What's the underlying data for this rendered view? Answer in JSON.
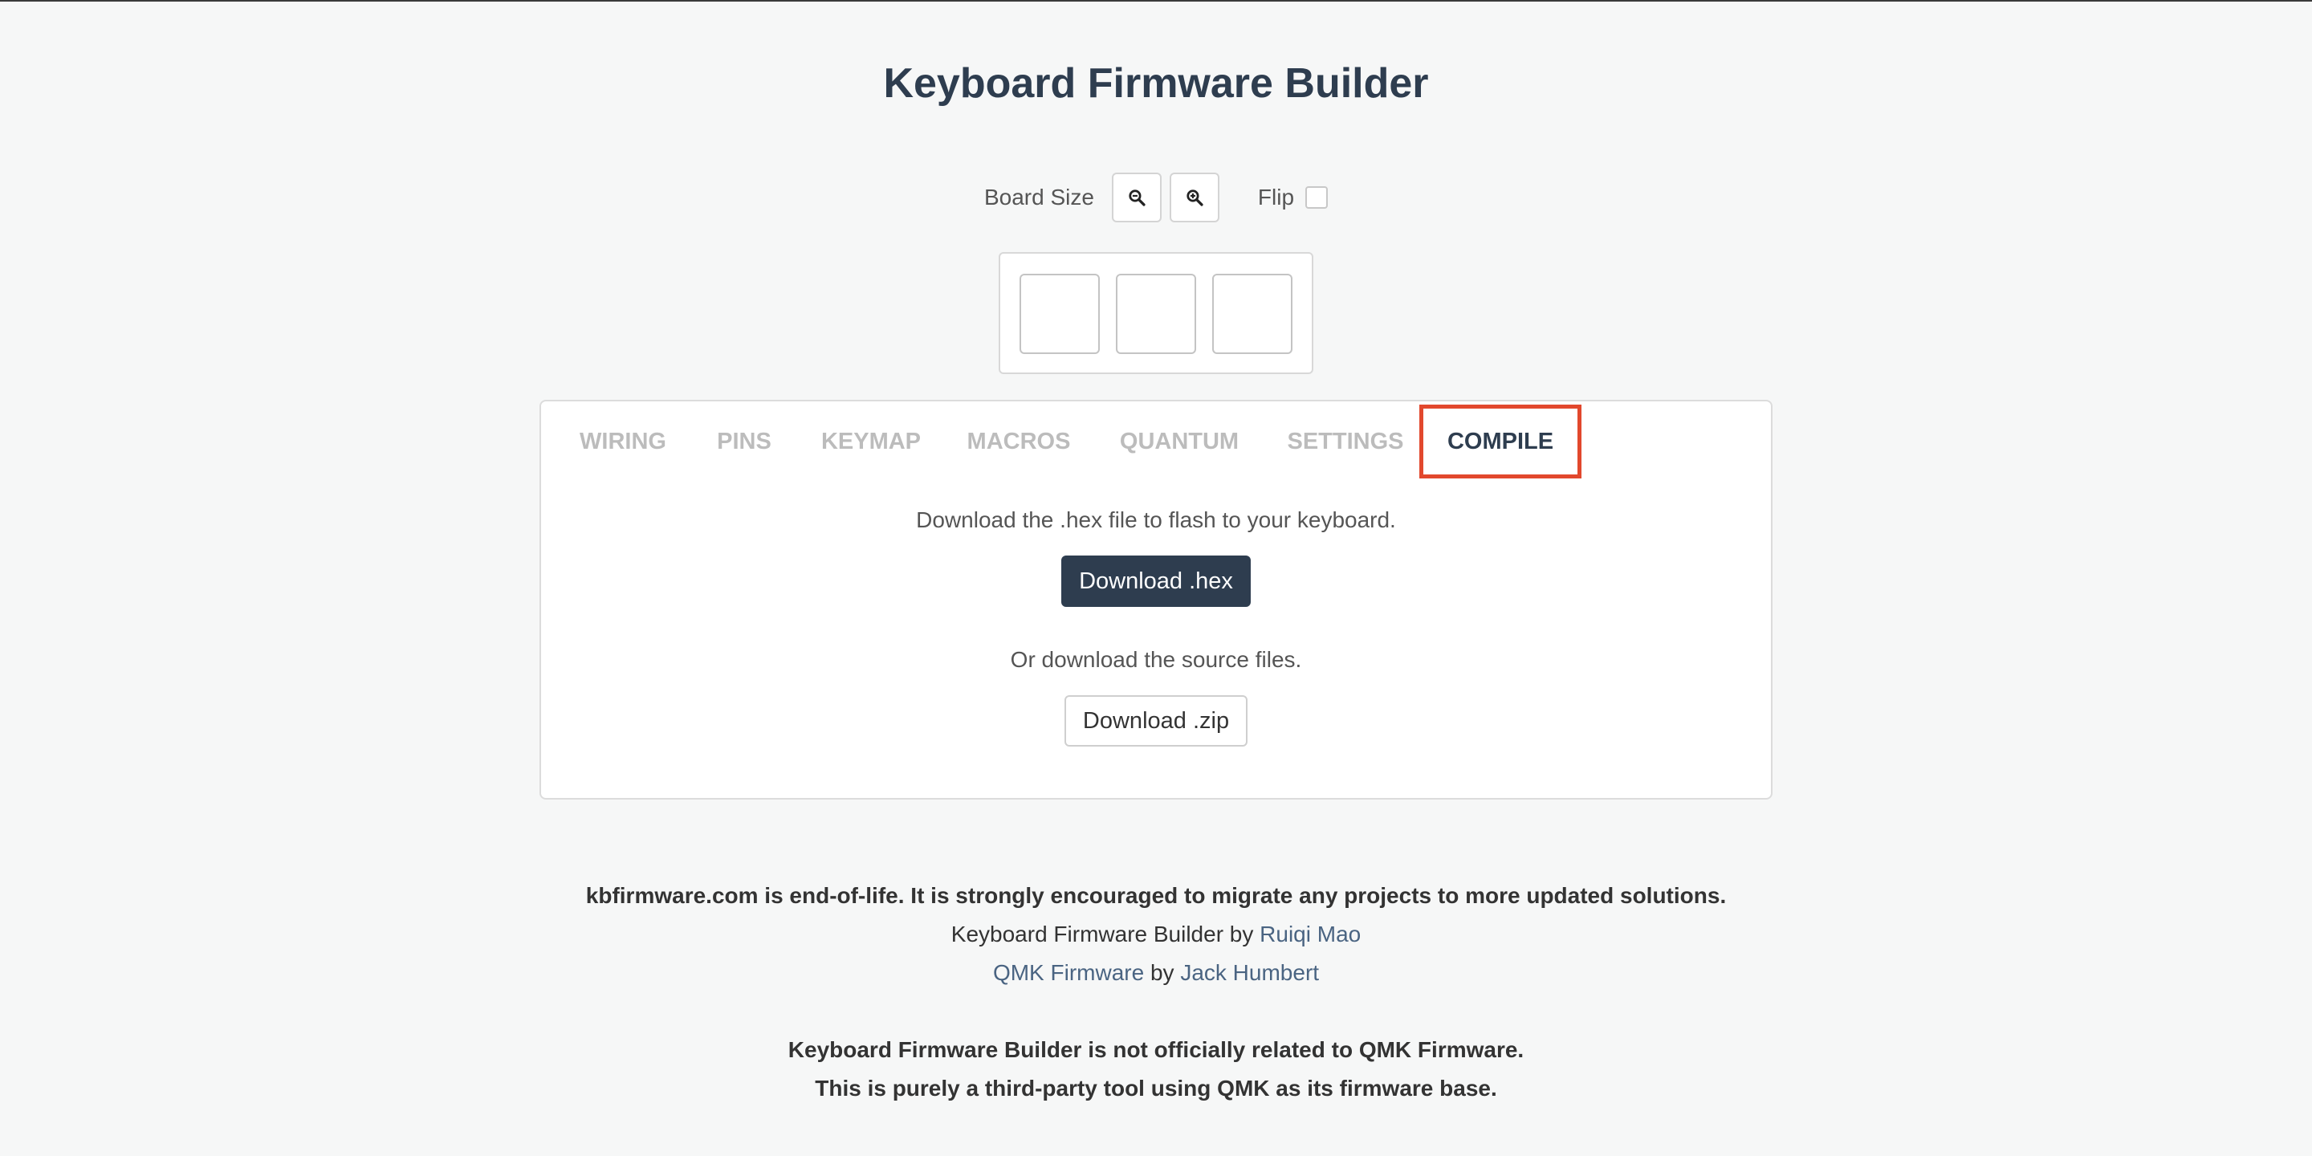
{
  "page": {
    "title": "Keyboard Firmware Builder"
  },
  "controls": {
    "board_size_label": "Board Size",
    "zoom_out_icon": "zoom-out-icon",
    "zoom_in_icon": "zoom-in-icon",
    "flip_label": "Flip",
    "flip_checked": false
  },
  "keyboard": {
    "key_count": 3
  },
  "tabs": [
    {
      "label": "WIRING",
      "active": false
    },
    {
      "label": "PINS",
      "active": false
    },
    {
      "label": "KEYMAP",
      "active": false
    },
    {
      "label": "MACROS",
      "active": false
    },
    {
      "label": "QUANTUM",
      "active": false
    },
    {
      "label": "SETTINGS",
      "active": false
    },
    {
      "label": "COMPILE",
      "active": true
    }
  ],
  "compile": {
    "hex_text": "Download the .hex file to flash to your keyboard.",
    "hex_button": "Download .hex",
    "zip_text": "Or download the source files.",
    "zip_button": "Download .zip"
  },
  "footer": {
    "eol_notice": "kbfirmware.com is end-of-life. It is strongly encouraged to migrate any projects to more updated solutions.",
    "builder_prefix": "Keyboard Firmware Builder by ",
    "builder_author": "Ruiqi Mao",
    "qmk_link": "QMK Firmware",
    "qmk_by": " by ",
    "qmk_author": "Jack Humbert",
    "disclaimer_1": "Keyboard Firmware Builder is not officially related to QMK Firmware.",
    "disclaimer_2": "This is purely a third-party tool using QMK as its firmware base."
  },
  "colors": {
    "accent": "#2e3d4f",
    "active_tab_outline": "#e2482d",
    "link": "#4a6482",
    "inactive_tab": "#bcbcbc"
  }
}
